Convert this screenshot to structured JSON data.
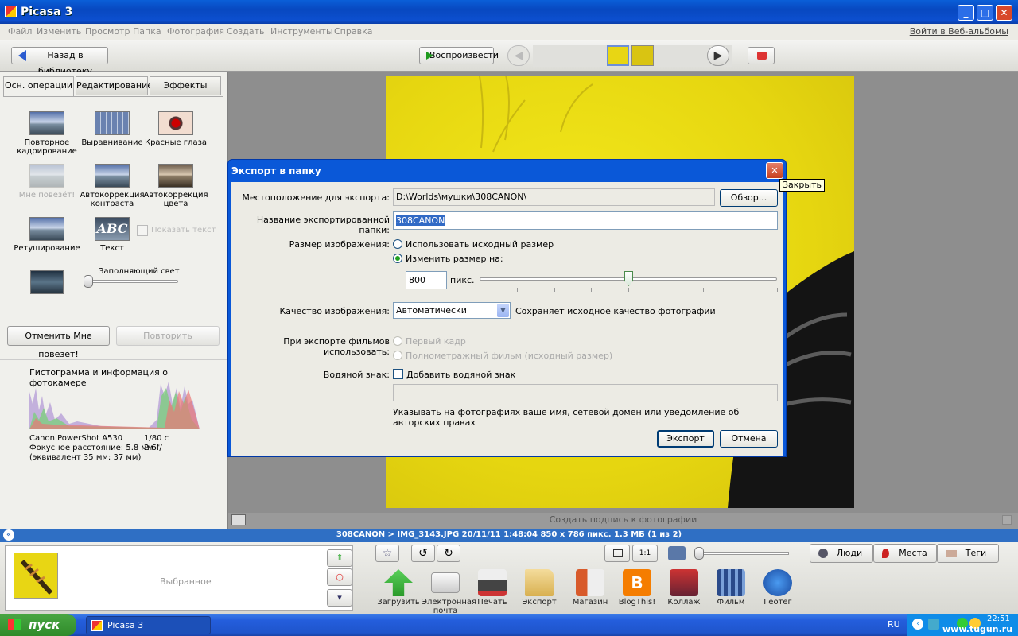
{
  "window": {
    "title": "Picasa 3"
  },
  "menu": {
    "items": [
      "Файл",
      "Изменить",
      "Просмотр",
      "Папка",
      "Фотография",
      "Создать",
      "Инструменты",
      "Справка"
    ],
    "web_link": "Войти в Веб-альбомы"
  },
  "toolbar": {
    "back_label": "Назад в библиотеку",
    "play_label": "Воспроизвести"
  },
  "left_panel": {
    "tabs": [
      "Осн. операции",
      "Редактирование",
      "Эффекты"
    ],
    "tools": [
      {
        "label": "Повторное кадрирование",
        "disabled": false
      },
      {
        "label": "Выравнивание",
        "disabled": false
      },
      {
        "label": "Красные глаза",
        "disabled": false
      },
      {
        "label": "Мне повезёт!",
        "disabled": true
      },
      {
        "label": "Автокоррекция контраста",
        "disabled": false
      },
      {
        "label": "Автокоррекция цвета",
        "disabled": false
      },
      {
        "label": "Ретуширование",
        "disabled": false
      },
      {
        "label": "Текст",
        "disabled": false
      }
    ],
    "show_text_label": "Показать текст",
    "fill_light_label": "Заполняющий свет",
    "fill_light_level": 0,
    "undo_label": "Отменить Мне повезёт!",
    "redo_label": "Повторить",
    "histogram_title": "Гистограмма и информация о фотокамере",
    "camera": {
      "model": "Canon PowerShot A530",
      "shutter": "1/80 с",
      "focal": "Фокусное расстояние: 5.8 мм",
      "aperture": "2.6f/",
      "equiv": "(эквивалент 35 мм:  37 мм)"
    }
  },
  "photo": {
    "caption_placeholder": "Создать подпись к фотографии"
  },
  "status": {
    "text": "308CANON > IMG_3143.JPG    20/11/11 1:48:04    850 x 786 пикс.    1.3 МБ    (1 из 2)"
  },
  "dialog": {
    "title": "Экспорт в папку",
    "close_tooltip": "Закрыть",
    "location_label": "Местоположение для экспорта:",
    "location_value": "D:\\Worlds\\мушки\\308CANON\\",
    "browse_label": "Обзор...",
    "folder_label": "Название экспортированной папки:",
    "folder_value": "308CANON",
    "size_label": "Размер изображения:",
    "size_opt1": "Использовать исходный размер",
    "size_opt2": "Изменить размер на:",
    "size_value": "800",
    "size_unit": "пикс.",
    "size_slider_fraction": 0.5,
    "quality_label": "Качество изображения:",
    "quality_value": "Автоматически",
    "quality_note": "Сохраняет исходное качество фотографии",
    "movie_label": "При экспорте фильмов использовать:",
    "movie_opt1": "Первый кадр",
    "movie_opt2": "Полнометражный фильм (исходный размер)",
    "watermark_label": "Водяной знак:",
    "watermark_check": "Добавить водяной знак",
    "watermark_note": "Указывать на фотографиях ваше имя, сетевой домен или уведомление об авторских правах",
    "export_label": "Экспорт",
    "cancel_label": "Отмена"
  },
  "tray": {
    "favorites_label": "Выбранное",
    "zoom_1_1": "1:1",
    "tabs": [
      "Люди",
      "Места",
      "Теги"
    ],
    "actions": [
      "Загрузить",
      "Электронная почта",
      "Печать",
      "Экспорт",
      "Магазин",
      "BlogThis!",
      "Коллаж",
      "Фильм",
      "Геотег"
    ]
  },
  "taskbar": {
    "start": "пуск",
    "task": "Picasa 3",
    "lang": "RU",
    "clock": "22:51",
    "watermark": "www.tugun.ru"
  }
}
